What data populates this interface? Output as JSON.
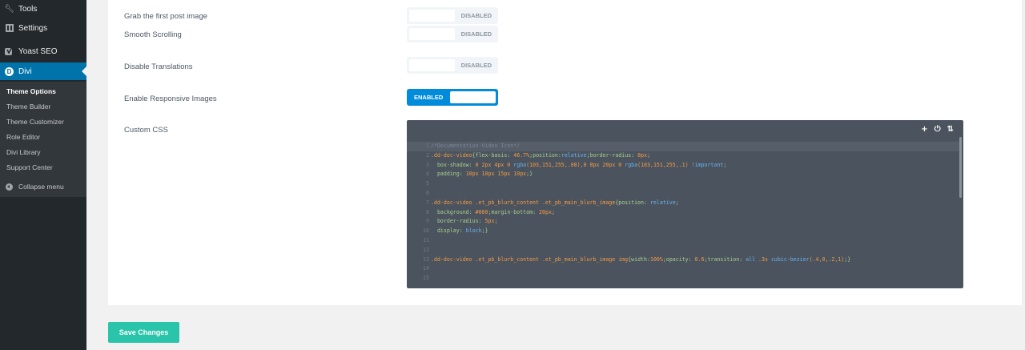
{
  "sidebar": {
    "items": [
      {
        "label": "Tools",
        "icon": "wrench-icon"
      },
      {
        "label": "Settings",
        "icon": "settings-icon"
      },
      {
        "label": "Yoast SEO",
        "icon": "yoast-icon"
      },
      {
        "label": "Divi",
        "icon": "divi-icon"
      }
    ],
    "submenu": [
      "Theme Options",
      "Theme Builder",
      "Theme Customizer",
      "Role Editor",
      "Divi Library",
      "Support Center"
    ],
    "collapse_label": "Collapse menu"
  },
  "options": [
    {
      "label": "Grab the first post image",
      "state": "DISABLED"
    },
    {
      "label": "Smooth Scrolling",
      "state": "DISABLED"
    },
    {
      "label": "Disable Translations",
      "state": "DISABLED"
    },
    {
      "label": "Enable Responsive Images",
      "state": "ENABLED"
    }
  ],
  "custom_css": {
    "label": "Custom CSS",
    "tools": {
      "add": "+",
      "power": "⏻",
      "sort": "⇅"
    },
    "lines": [
      "/*Documentation-Video Icon*/",
      ".dd-doc-video{flex-basis: 46.7%;position:relative;border-radius: 8px;",
      "  box-shadow: 0 2px 4px 0 rgba(103,151,255,.08),0 8px 20px 0 rgba(103,151,255,.1) !important;",
      "  padding: 10px 10px 15px 10px;}",
      "",
      "",
      ".dd-doc-video .et_pb_blurb_content .et_pb_main_blurb_image{position: relative;",
      "  background: #000;margin-bottom: 20px;",
      "  border-radius: 5px;",
      "  display: block;}",
      "",
      "",
      ".dd-doc-video .et_pb_blurb_content .et_pb_main_blurb_image img{width:100%;opacity: 0.6;transition: all .3s cubic-bezier(.4,0,.2,1);}",
      "",
      ""
    ]
  },
  "save_button": "Save Changes"
}
